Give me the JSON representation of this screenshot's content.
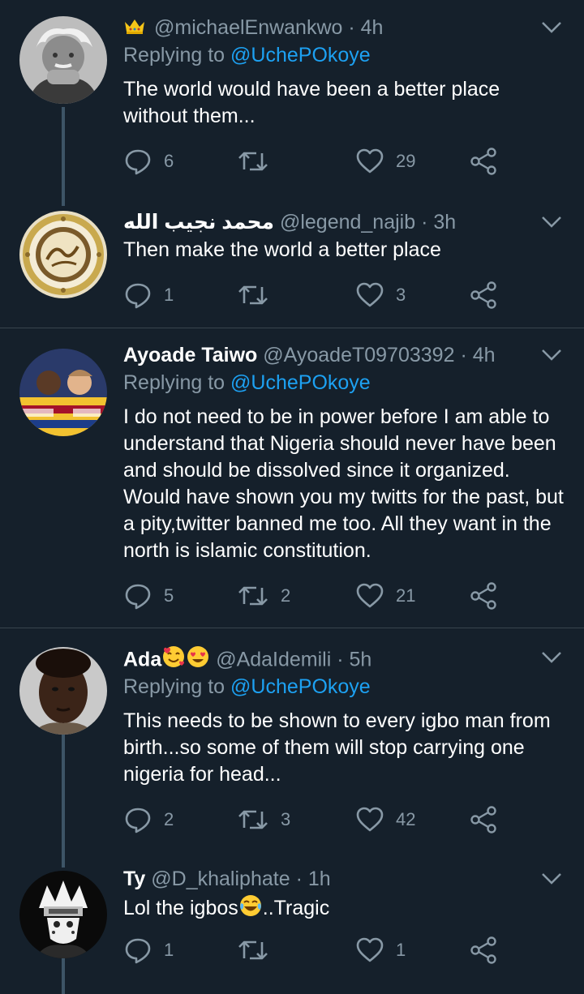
{
  "tweets": [
    {
      "display_name": "",
      "handle": "@michaelEnwankwo",
      "time": "· 4h",
      "reply_label": "Replying to",
      "reply_handle": "@UchePOkoye",
      "text": "The world would have been a better place without them...",
      "replies": "6",
      "retweets": "",
      "likes": "29",
      "icon": "crown-icon"
    },
    {
      "display_name": "محمد نجيب الله",
      "handle": "@legend_najib",
      "time": "· 3h",
      "text": "Then make the world a better place",
      "replies": "1",
      "retweets": "",
      "likes": "3"
    },
    {
      "display_name": "Ayoade Taiwo",
      "handle": "@AyoadeT09703392",
      "time": "· 4h",
      "reply_label": "Replying to",
      "reply_handle": "@UchePOkoye",
      "text": "I do not need to be in power before I am able to understand that Nigeria should never have been and should be dissolved since it organized. Would have shown you my twitts for the past, but a pity,twitter banned me too. All they want in the north is islamic constitution.",
      "replies": "5",
      "retweets": "2",
      "likes": "21"
    },
    {
      "display_name": "Ada",
      "handle": "@AdaIdemili",
      "time": "· 5h",
      "reply_label": "Replying to",
      "reply_handle": "@UchePOkoye",
      "text": "This needs to be shown to every igbo man from birth...so some of them will stop carrying one nigeria for head...",
      "replies": "2",
      "retweets": "3",
      "likes": "42",
      "name_emojis": [
        "smiling-face-with-hearts",
        "heart-eyes"
      ]
    },
    {
      "display_name": "Ty",
      "handle": "@D_khaliphate",
      "time": "· 1h",
      "text_before": "Lol the igbos",
      "text_after": "..Tragic",
      "text_emoji": "tears-of-joy",
      "replies": "1",
      "retweets": "",
      "likes": "1"
    }
  ],
  "colors": {
    "background": "#15202b",
    "secondary_text": "#8899a6",
    "link": "#1da1f2",
    "divider": "#38444d",
    "thread_line": "#3d5466"
  }
}
